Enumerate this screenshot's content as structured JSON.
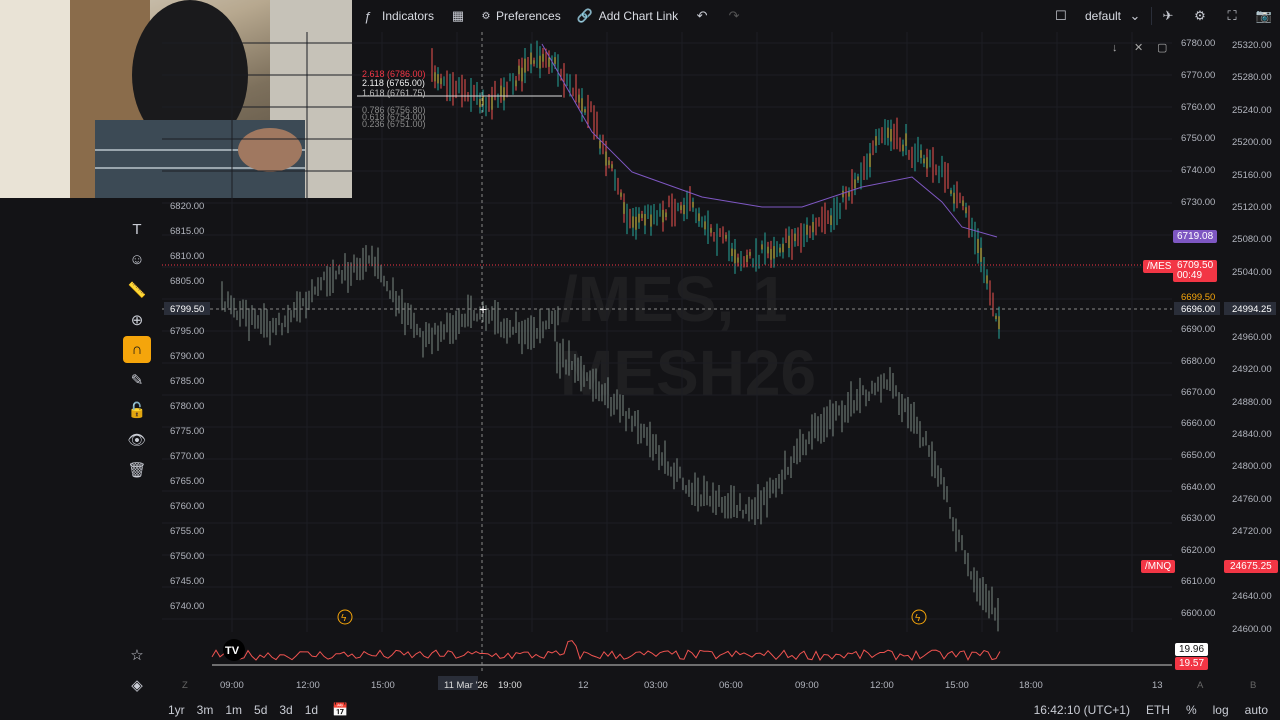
{
  "toolbar": {
    "indicators": "Indicators",
    "preferences": "Preferences",
    "add_chart_link": "Add Chart Link",
    "layout": "default"
  },
  "watermark": {
    "line1": "/MES, 1",
    "line2": "MESH26"
  },
  "fib": {
    "l1": "2.618 (6786.00)",
    "l2": "2.118 (6765.00)",
    "l3": "1.618 (6761.75)",
    "l4": "0.786 (6756.80)",
    "l5": "0.618 (6754.00)",
    "l6": "0.236 (6751.00)"
  },
  "price_axis_right": [
    "6780.00",
    "6770.00",
    "6760.00",
    "6750.00",
    "6740.00",
    "6730.00",
    "6719.08",
    "6709.50",
    "6699.50",
    "6696.00",
    "6690.00",
    "6680.00",
    "6670.00",
    "6660.00",
    "6650.00",
    "6640.00",
    "6630.00",
    "6620.00",
    "6610.00",
    "6600.00"
  ],
  "price_axis_far": [
    "25320.00",
    "25280.00",
    "25240.00",
    "25200.00",
    "25160.00",
    "25120.00",
    "25080.00",
    "25040.00",
    "24994.25",
    "24960.00",
    "24920.00",
    "24880.00",
    "24840.00",
    "24800.00",
    "24760.00",
    "24720.00",
    "24675.25",
    "24640.00",
    "24600.00"
  ],
  "price_axis_left": [
    "6820.00",
    "6815.00",
    "6810.00",
    "6805.00",
    "6799.50",
    "6795.00",
    "6790.00",
    "6785.00",
    "6780.00",
    "6775.00",
    "6770.00",
    "6765.00",
    "6760.00",
    "6755.00",
    "6750.00",
    "6745.00",
    "6740.00"
  ],
  "labels": {
    "mes_tag": "/MES",
    "mes_price": "6709.50",
    "mes_time": "00:49",
    "mnq_tag": "/MNQ",
    "mnq_price": "24675.25",
    "purple_price": "6719.08",
    "vol1": "19.96",
    "vol2": "19.57"
  },
  "time_axis": [
    "09:00",
    "12:00",
    "15:00",
    "11 Mar '26",
    "19:00",
    "12",
    "03:00",
    "06:00",
    "09:00",
    "12:00",
    "15:00",
    "18:00",
    "13"
  ],
  "axis_small": {
    "z": "Z",
    "a": "A",
    "b": "B"
  },
  "bottombar": {
    "ranges": [
      "1yr",
      "3m",
      "1m",
      "5d",
      "3d",
      "1d"
    ],
    "clock": "16:42:10 (UTC+1)",
    "session": "ETH",
    "pct": "%",
    "log": "log",
    "auto": "auto"
  },
  "colors": {
    "up": "#26a69a",
    "down": "#ef5350",
    "mes": "#f23645",
    "purple": "#7e57c2",
    "accent": "#f5a50b"
  }
}
